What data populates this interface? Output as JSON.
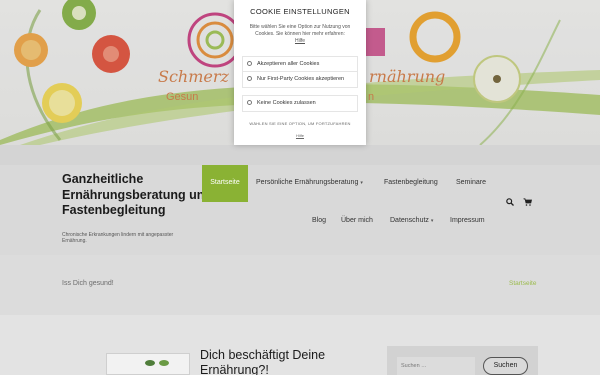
{
  "hero": {
    "banner_line1": "Schmerz",
    "banner_line1b": "rnährung",
    "banner_line2a": "Gesun",
    "banner_line2b": "n"
  },
  "header": {
    "site_title": "Ganzheitliche Ernährungsberatung und Fastenbegleitung",
    "tagline": "Chronische Erkrankungen lindern mit angepasster Ernährung."
  },
  "nav": {
    "items": [
      {
        "label": "Startseite",
        "active": true
      },
      {
        "label": "Persönliche Ernährungsberatung",
        "has_submenu": true
      },
      {
        "label": "Fastenbegleitung"
      },
      {
        "label": "Seminare"
      },
      {
        "label": "Blog"
      },
      {
        "label": "Über mich"
      },
      {
        "label": "Datenschutz",
        "has_submenu": true
      },
      {
        "label": "Impressum"
      }
    ],
    "caret": "▾",
    "search_icon": "search-icon",
    "cart_icon": "cart-icon"
  },
  "strip": {
    "text": "Iss Dich gesund!",
    "breadcrumb": "Startseite"
  },
  "content": {
    "post_title": "Dich beschäftigt Deine Ernährung?!"
  },
  "sidebar": {
    "search_placeholder": "Suchen …",
    "search_button": "Suchen"
  },
  "cookie_modal": {
    "title": "COOKIE EINSTELLUNGEN",
    "description": "Bitte wählen Sie eine Option zur Nutzung von Cookies. Sie können hier mehr erfahren:",
    "help_link": "Hilfe",
    "options": [
      "Akzeptieren aller Cookies",
      "Nur First-Party Cookies akzeptieren",
      "Keine Cookies zulassen"
    ],
    "hint": "WÄHLEN SIE EINE OPTION, UM FORTZUFAHREN",
    "help_footer": "Hilfe"
  },
  "colors": {
    "accent_green": "#8ab234",
    "breadcrumb_green": "#9bbb4c"
  }
}
